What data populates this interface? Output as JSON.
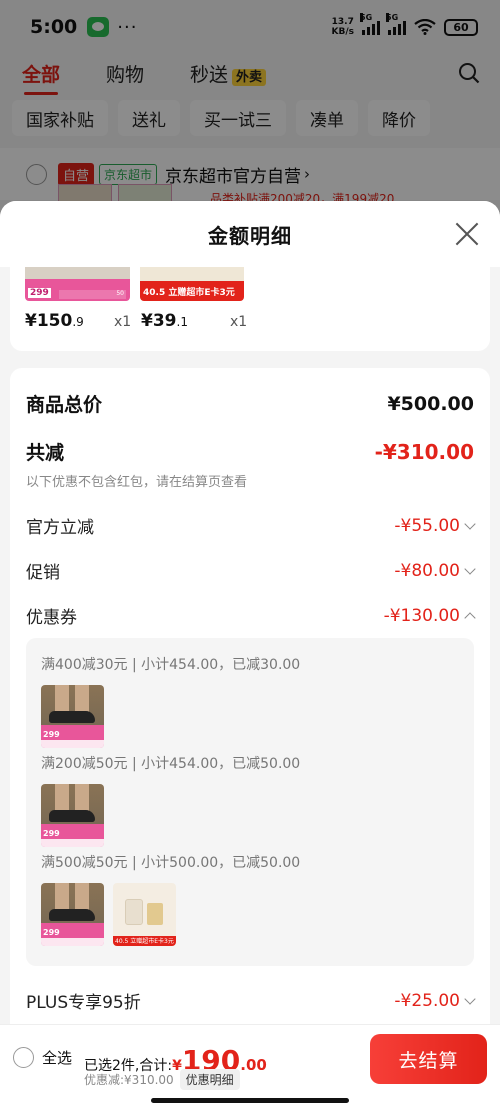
{
  "status_bar": {
    "time": "5:00",
    "dots": "···",
    "net_speed_top": "13.7",
    "net_speed_bottom": "KB/s",
    "sim1": "5G",
    "sim2": "5G",
    "battery": "60"
  },
  "top_tabs": [
    "全部",
    "购物",
    "秒送"
  ],
  "waimai_badge": "外卖",
  "filter_chips": [
    "国家补贴",
    "送礼",
    "买一试三",
    "凑单",
    "降价"
  ],
  "store": {
    "tag_self": "自营",
    "tag_jd": "京东超市",
    "name": "京东超市官方自营",
    "chevron": "›",
    "promo_peek": "品类补贴满200减20，满199减20"
  },
  "sheet": {
    "title": "金额明细",
    "products": [
      {
        "price_int": "¥150",
        "price_dec": ".9",
        "qty": "x1",
        "thumb_text": "299",
        "thumb_sub": "50"
      },
      {
        "price_int": "¥39",
        "price_dec": ".1",
        "qty": "x1",
        "thumb_text": "40.5 立赠超市E卡3元"
      }
    ],
    "total": {
      "label": "商品总价",
      "value": "¥500.00"
    },
    "reduce": {
      "label": "共减",
      "value": "-¥310.00",
      "note": "以下优惠不包含红包，请在结算页查看"
    },
    "lines": [
      {
        "label": "官方立减",
        "value": "-¥55.00"
      },
      {
        "label": "促销",
        "value": "-¥80.00"
      },
      {
        "label": "优惠券",
        "value": "-¥130.00"
      }
    ],
    "coupons": [
      "满400减30元 | 小计454.00，已减30.00",
      "满200减50元 | 小计454.00，已减50.00",
      "满500减50元 | 小计500.00，已减50.00"
    ],
    "coupon_thumb_price": "299",
    "coupon_thumb_b_text": "40.5 立赠超市E卡3元",
    "plus": {
      "label": "PLUS专享95折",
      "value": "-¥25.00"
    }
  },
  "bottom": {
    "select_all": "全选",
    "selected_text": "已选2件,合计:",
    "price_yen": "¥",
    "price_int": "190",
    "price_dec": ".00",
    "discount_text": "优惠减:¥310.00",
    "detail_btn": "优惠明细",
    "checkout": "去结算"
  },
  "colors": {
    "accent": "#e2231a",
    "overlay": "rgba(0,0,0,0.45)"
  }
}
